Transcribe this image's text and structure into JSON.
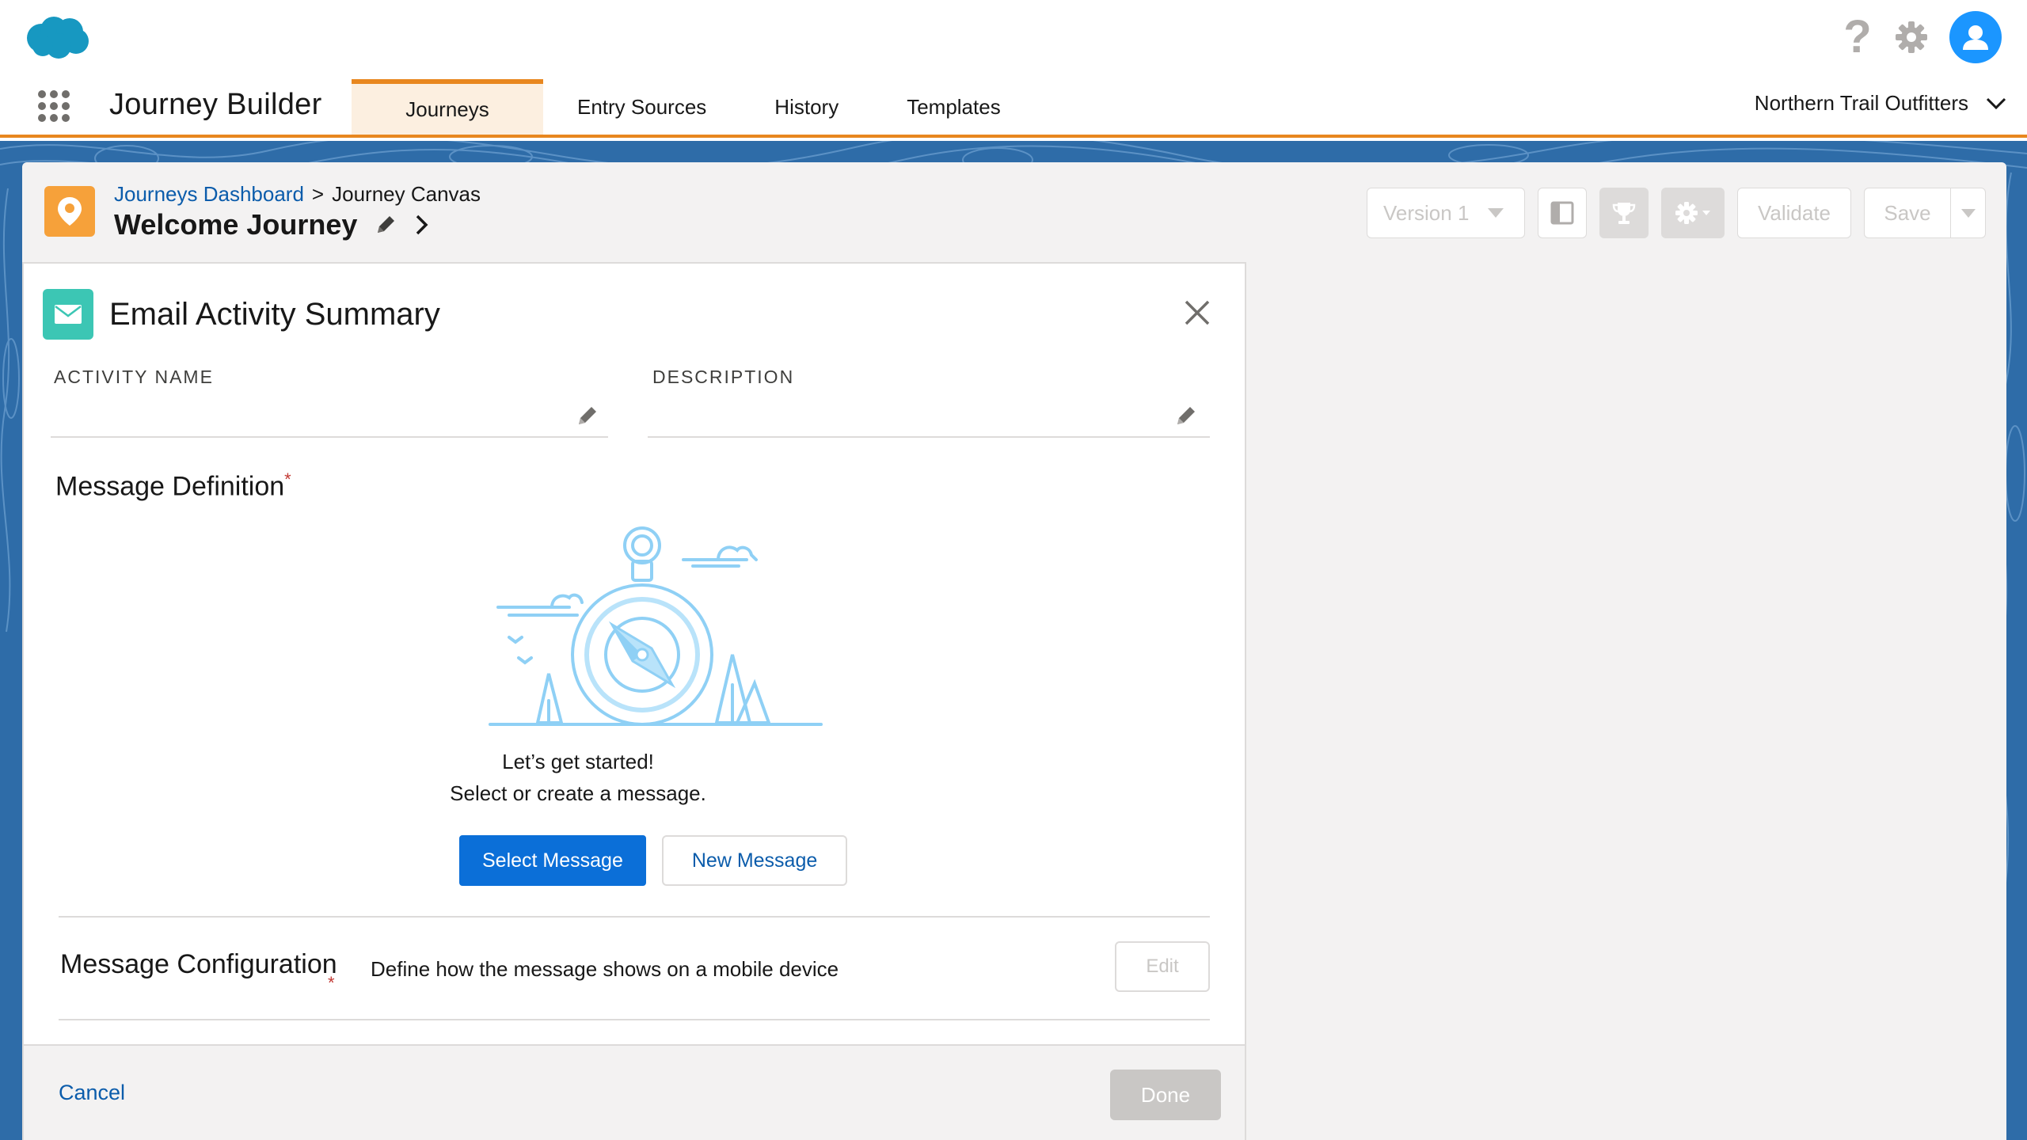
{
  "header": {
    "logo_icon": "salesforce-cloud-logo",
    "help_icon": "question-icon",
    "help_glyph": "?",
    "settings_icon": "gear-icon",
    "avatar_icon": "user-avatar"
  },
  "nav": {
    "app_name": "Journey Builder",
    "tabs": [
      {
        "label": "Journeys",
        "active": true
      },
      {
        "label": "Entry Sources",
        "active": false
      },
      {
        "label": "History",
        "active": false
      },
      {
        "label": "Templates",
        "active": false
      }
    ],
    "org_name": "Northern Trail Outfitters",
    "accent_color": "#e8871f"
  },
  "page_header": {
    "breadcrumb_link": "Journeys Dashboard",
    "breadcrumb_separator": ">",
    "breadcrumb_current": "Journey Canvas",
    "title": "Welcome Journey",
    "version_label": "Version 1",
    "validate_label": "Validate",
    "save_label": "Save"
  },
  "panel": {
    "title": "Email Activity Summary",
    "activity_name_label": "ACTIVITY NAME",
    "activity_name_value": "",
    "description_label": "DESCRIPTION",
    "description_value": "",
    "message_definition_label": "Message Definition",
    "required_marker": "*",
    "empty_title": "Let’s get started!",
    "empty_subtitle": "Select or create a message.",
    "select_message_label": "Select Message",
    "new_message_label": "New Message",
    "message_config_label": "Message Configuration",
    "message_config_desc": "Define how the message shows on a mobile device",
    "edit_label": "Edit",
    "cancel_label": "Cancel",
    "done_label": "Done"
  },
  "colors": {
    "brand_blue": "#0b6fd8",
    "link_blue": "#0b5cab",
    "journey_icon_bg": "#f6a13a",
    "email_icon_bg": "#3cc6b4",
    "background_band": "#2e6ca8"
  }
}
